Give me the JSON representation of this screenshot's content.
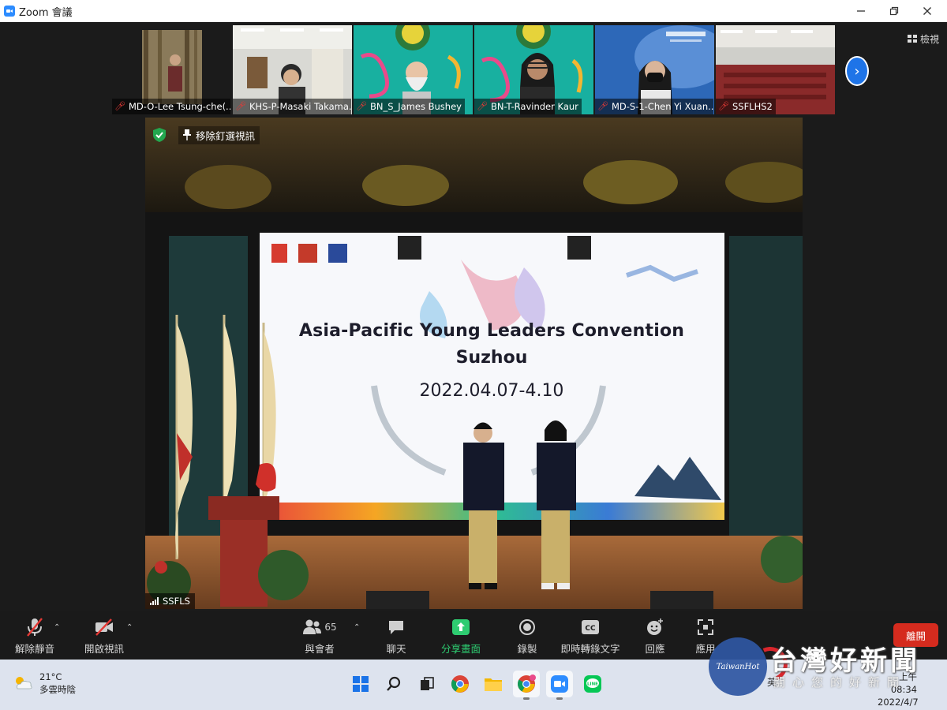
{
  "window": {
    "title": "Zoom 會議"
  },
  "strip": {
    "participants": [
      {
        "name": "MD-O-Lee Tsung-che(..."
      },
      {
        "name": "KHS-P-Masaki Takama..."
      },
      {
        "name": "BN_S_James Bushey"
      },
      {
        "name": "BN-T-Ravinder Kaur"
      },
      {
        "name": "MD-S-1-Chen Yi Xuan..."
      },
      {
        "name": "SSFLHS2"
      }
    ],
    "view_label": "檢視"
  },
  "main_video": {
    "unpin_label": "移除釘選視訊",
    "slide": {
      "title": "Asia-Pacific Young Leaders Convention",
      "city": "Suzhou",
      "date": "2022.04.07-4.10"
    },
    "speaker_name": "SSFLS"
  },
  "toolbar": {
    "unmute": "解除靜音",
    "start_video": "開啟視訊",
    "participants": "與會者",
    "participant_count": "65",
    "chat": "聊天",
    "share_screen": "分享畫面",
    "record": "錄製",
    "transcript": "即時轉錄文字",
    "reactions": "回應",
    "apps": "應用",
    "leave": "離開"
  },
  "taskbar": {
    "weather_temp": "21°C",
    "weather_desc": "多雲時陰",
    "ime": "英",
    "time": "上午 08:34",
    "date": "2022/4/7"
  },
  "watermark": {
    "title": "台灣好新聞",
    "subtitle": "關心您的好新聞",
    "logo_text": "TaiwanHot"
  },
  "colors": {
    "zoom_blue": "#2d8cff",
    "leave_red": "#d52b1e",
    "share_green": "#2ecc71",
    "muted_red": "#e53935"
  }
}
